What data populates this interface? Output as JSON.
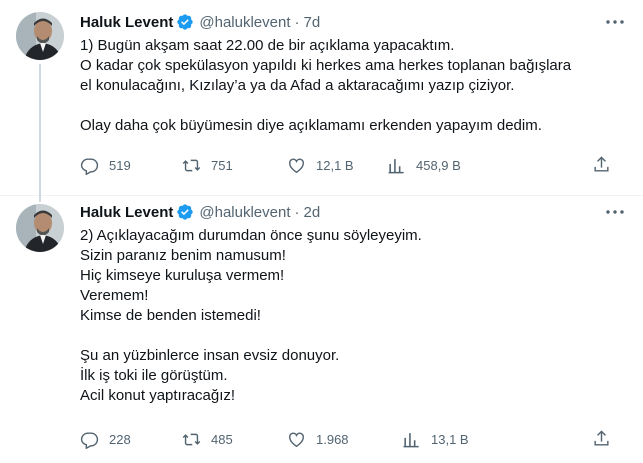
{
  "tweets": [
    {
      "author_name": "Haluk Levent",
      "handle": "@haluklevent",
      "separator": "·",
      "time": "7d",
      "lines": [
        "1) Bugün akşam saat 22.00 de bir açıklama yapacaktım.",
        "O kadar çok spekülasyon yapıldı ki herkes ama herkes toplanan bağışlara",
        "el konulacağını, Kızılay’a ya da Afad a aktaracağımı yazıp çiziyor.",
        "",
        "Olay daha çok büyümesin diye açıklamamı erkenden yapayım dedim."
      ],
      "replies": "519",
      "retweets": "751",
      "likes": "12,1 B",
      "views": "458,9 B"
    },
    {
      "author_name": "Haluk Levent",
      "handle": "@haluklevent",
      "separator": "·",
      "time": "2d",
      "lines": [
        "2) Açıklayacağım durumdan önce şunu söyleyeyim.",
        "Sizin paranız benim namusum!",
        "Hiç kimseye kuruluşa vermem!",
        "Veremem!",
        "Kimse de benden istemedi!",
        "",
        "Şu an yüzbinlerce insan evsiz donuyor.",
        "İlk iş toki ile görüştüm.",
        "Acil konut yaptıracağız!"
      ],
      "replies": "228",
      "retweets": "485",
      "likes": "1.968",
      "views": "13,1 B"
    }
  ],
  "colors": {
    "text": "#0f1419",
    "secondary": "#536471",
    "verified": "#1d9bf0",
    "thread_line": "#cfd9de",
    "divider": "#eff3f4"
  },
  "icons": [
    "verified-badge-icon",
    "more-icon",
    "reply-icon",
    "retweet-icon",
    "like-icon",
    "views-icon",
    "share-icon"
  ]
}
